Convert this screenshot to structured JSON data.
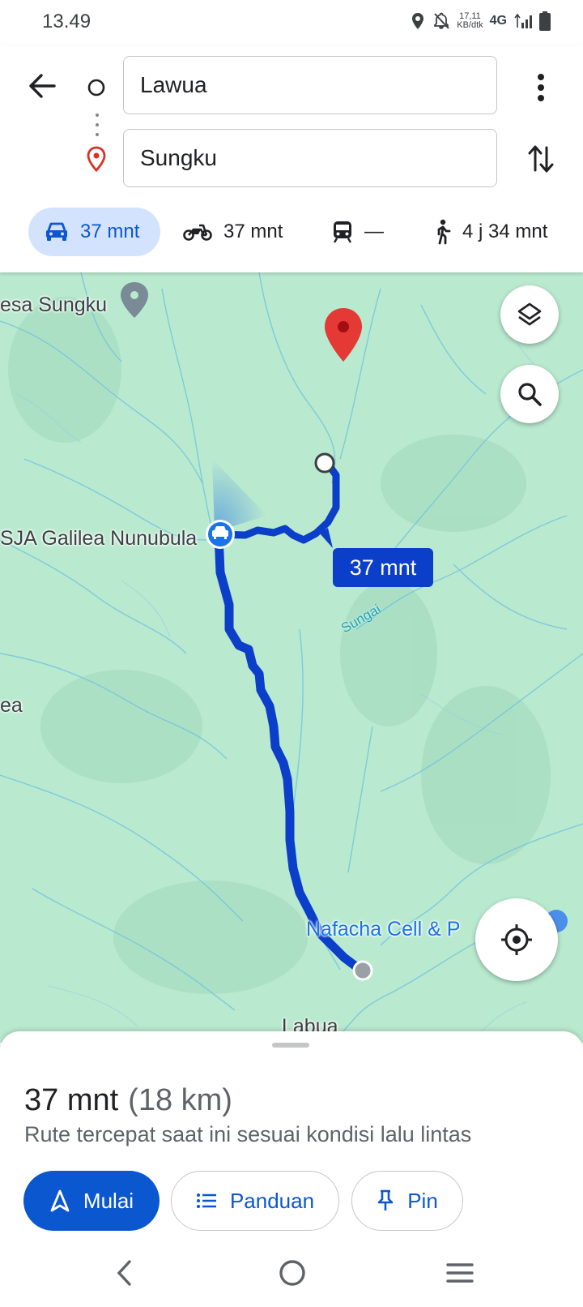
{
  "status_bar": {
    "time": "13.49",
    "net_speed_value": "17,11",
    "net_speed_unit": "KB/dtk",
    "network_type": "4G"
  },
  "directions": {
    "origin": "Lawua",
    "destination": "Sungku"
  },
  "travel_modes": [
    {
      "mode": "car",
      "label": "37 mnt",
      "active": true
    },
    {
      "mode": "motorcycle",
      "label": "37 mnt",
      "active": false
    },
    {
      "mode": "transit",
      "label": "—",
      "active": false
    },
    {
      "mode": "walk",
      "label": "4 j 34 mnt",
      "active": false
    }
  ],
  "map": {
    "labels": {
      "desa_sungku": "esa Sungku",
      "galilea": "SJA Galilea Nunubula",
      "ea": "ea",
      "nafacha": "Nafacha Cell & P",
      "labua": "Labua",
      "river": "Sungai"
    },
    "route_eta": "37 mnt",
    "colors": {
      "route": "#0b3ec9",
      "map_bg": "#b9e9cf",
      "destination_pin": "#e53935"
    }
  },
  "sheet": {
    "duration": "37 mnt",
    "distance": "(18 km)",
    "description": "Rute tercepat saat ini sesuai kondisi lalu lintas",
    "buttons": {
      "start": "Mulai",
      "guide": "Panduan",
      "pin": "Pin"
    }
  }
}
